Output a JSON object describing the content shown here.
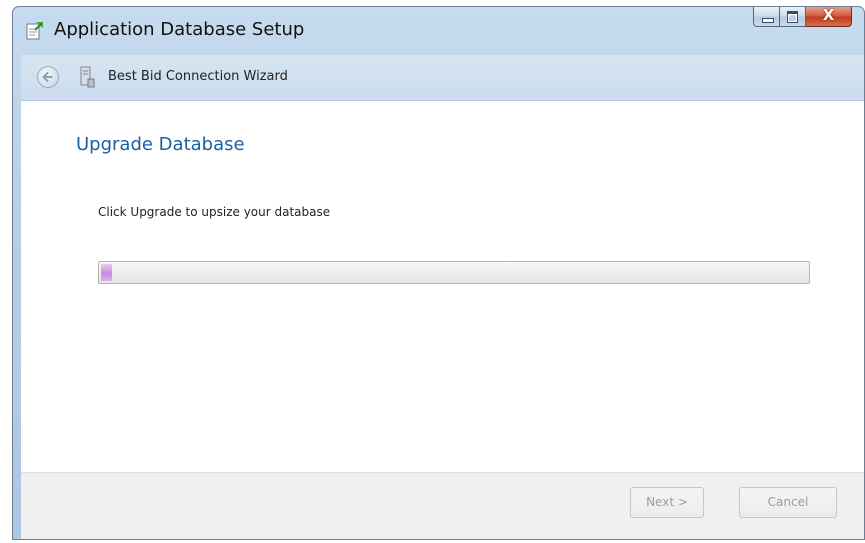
{
  "window": {
    "title": "Application Database Setup",
    "icon": "setup-document-icon",
    "caption_buttons": {
      "minimize": "minimize-icon",
      "maximize": "maximize-icon",
      "close": "X"
    }
  },
  "navbar": {
    "back_icon": "back-arrow-icon",
    "wizard_icon": "database-server-icon",
    "wizard_title": "Best Bid Connection Wizard"
  },
  "main": {
    "heading": "Upgrade Database",
    "instruction": "Click Upgrade to upsize your database",
    "progress": {
      "value_fraction": 0.015
    }
  },
  "footer": {
    "next_label": "Next >",
    "cancel_label": "Cancel"
  },
  "colors": {
    "heading": "#1c5fa3",
    "progress_fill": "#c98be0",
    "disabled_text": "#9d9d9d",
    "close_button": "#c13b1e"
  }
}
